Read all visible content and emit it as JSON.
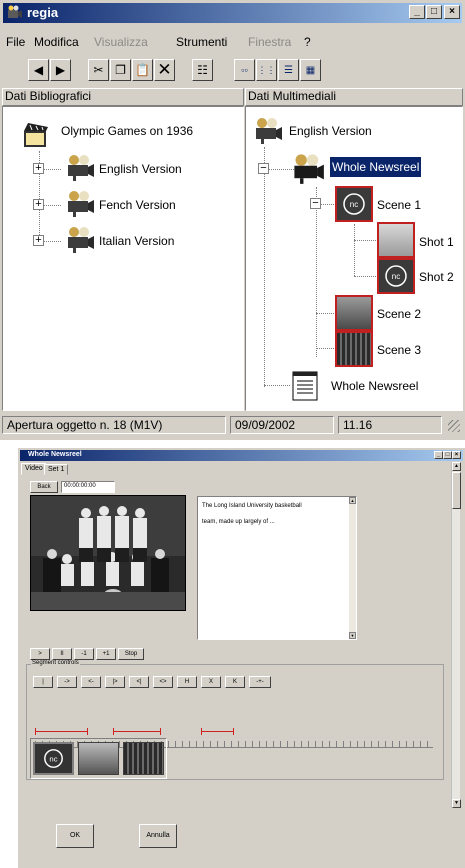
{
  "main_window": {
    "title": "regia",
    "menu": [
      {
        "label": "File",
        "enabled": true
      },
      {
        "label": "Modifica",
        "enabled": true
      },
      {
        "label": "Visualizza",
        "enabled": false
      },
      {
        "label": "Strumenti",
        "enabled": true
      },
      {
        "label": "Finestra",
        "enabled": false
      },
      {
        "label": "?",
        "enabled": true
      }
    ],
    "toolbar_icons": [
      "prev-icon",
      "next-icon",
      "cut-icon",
      "copy-icon",
      "paste-icon",
      "delete-icon",
      "properties-icon",
      "view-large-icon",
      "view-small-icon",
      "view-list-icon",
      "view-details-icon"
    ],
    "left_pane": {
      "header": "Dati Bibliografici",
      "root": "Olympic Games on 1936",
      "items": [
        "English Version",
        "Fench Version",
        "Italian Version"
      ]
    },
    "right_pane": {
      "header": "Dati Multimediali",
      "root": "English Version",
      "whole": "Whole Newsreel",
      "scene1": "Scene 1",
      "shot1": "Shot 1",
      "shot2": "Shot 2",
      "scene2": "Scene 2",
      "scene3": "Scene 3",
      "doc": "Whole Newsreel"
    },
    "status": {
      "message": "Apertura oggetto n. 18 (M1V)",
      "date": "09/09/2002",
      "time": "11.16"
    }
  },
  "sub_window": {
    "title": "Whole Newsreel",
    "tabs": [
      "Video",
      "Set 1"
    ],
    "back_label": "Back",
    "timecode": "00:00:00:00",
    "description_lines": [
      "The Long Island University basketball",
      "team, made up largely of ..."
    ],
    "player_buttons": [
      ">",
      "II",
      "-1",
      "+1",
      "Stop"
    ],
    "segment_label": "Segment controls",
    "segment_buttons": [
      "|",
      "->",
      "<-",
      "|>",
      "<|",
      "<>",
      "H",
      "X",
      "K",
      "-+-"
    ],
    "ok_label": "OK",
    "cancel_label": "Annulla"
  },
  "colors": {
    "title_bar": "#0a246a",
    "selection": "#0a246a",
    "segment_red": "#d02020",
    "thumb_border": "#c02020"
  }
}
